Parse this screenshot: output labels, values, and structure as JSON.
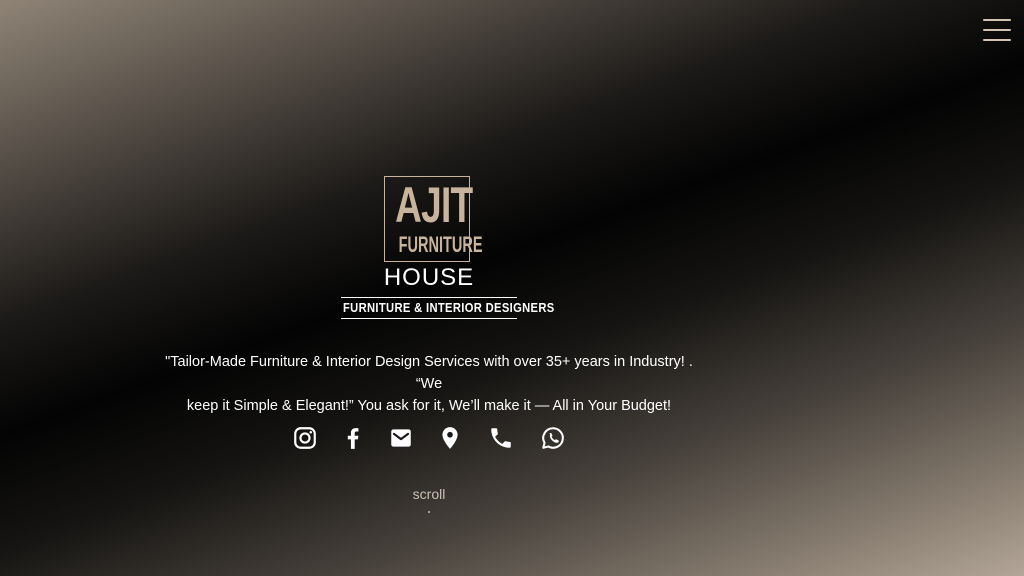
{
  "header": {
    "menu_icon": "hamburger-menu-icon"
  },
  "logo": {
    "main": "AJIT",
    "sub": "FURNITURE",
    "house": "HOUSE",
    "tagline": "FURNITURE & INTERIOR DESIGNERS",
    "color": "#c8b49c"
  },
  "hero": {
    "line1": "\"Tailor-Made Furniture & Interior Design Services with over 35+ years in Industry! . “We",
    "line2": "keep it Simple & Elegant!” You ask for it, We’ll make it — All in Your Budget!"
  },
  "social_icons": [
    "instagram-icon",
    "facebook-icon",
    "email-icon",
    "location-pin-icon",
    "phone-icon",
    "whatsapp-icon"
  ],
  "scroll": {
    "label": "scroll"
  }
}
